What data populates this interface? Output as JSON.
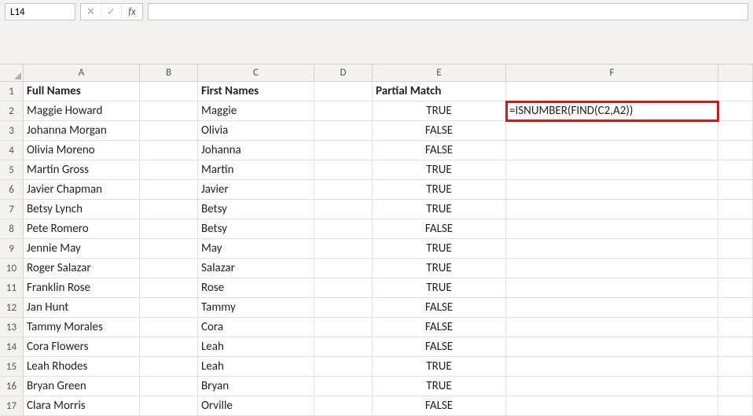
{
  "nameBox": {
    "value": "L14"
  },
  "formulaBar": {
    "value": ""
  },
  "columns": [
    "A",
    "B",
    "C",
    "D",
    "E",
    "F",
    ""
  ],
  "headers": {
    "A": "Full Names",
    "C": "First Names",
    "E": "Partial Match"
  },
  "highlightedFormula": "=ISNUMBER(FIND(C2,A2))",
  "chart_data": {
    "type": "table",
    "title": "",
    "columns": [
      "Row",
      "Full Names",
      "First Names",
      "Partial Match"
    ],
    "rows": [
      {
        "row": 2,
        "full": "Maggie Howard",
        "first": "Maggie",
        "match": "TRUE"
      },
      {
        "row": 3,
        "full": "Johanna Morgan",
        "first": "Olivia",
        "match": "FALSE"
      },
      {
        "row": 4,
        "full": "Olivia Moreno",
        "first": "Johanna",
        "match": "FALSE"
      },
      {
        "row": 5,
        "full": "Martin Gross",
        "first": "Martin",
        "match": "TRUE"
      },
      {
        "row": 6,
        "full": "Javier Chapman",
        "first": "Javier",
        "match": "TRUE"
      },
      {
        "row": 7,
        "full": "Betsy Lynch",
        "first": "Betsy",
        "match": "TRUE"
      },
      {
        "row": 8,
        "full": "Pete Romero",
        "first": "Betsy",
        "match": "FALSE"
      },
      {
        "row": 9,
        "full": "Jennie May",
        "first": "May",
        "match": "TRUE"
      },
      {
        "row": 10,
        "full": "Roger Salazar",
        "first": "Salazar",
        "match": "TRUE"
      },
      {
        "row": 11,
        "full": "Franklin Rose",
        "first": "Rose",
        "match": "TRUE"
      },
      {
        "row": 12,
        "full": "Jan Hunt",
        "first": "Tammy",
        "match": "FALSE"
      },
      {
        "row": 13,
        "full": "Tammy Morales",
        "first": "Cora",
        "match": "FALSE"
      },
      {
        "row": 14,
        "full": "Cora Flowers",
        "first": "Leah",
        "match": "FALSE"
      },
      {
        "row": 15,
        "full": "Leah Rhodes",
        "first": "Leah",
        "match": "TRUE"
      },
      {
        "row": 16,
        "full": "Bryan Green",
        "first": "Bryan",
        "match": "TRUE"
      },
      {
        "row": 17,
        "full": "Clara Morris",
        "first": "Orville",
        "match": "FALSE"
      }
    ]
  }
}
